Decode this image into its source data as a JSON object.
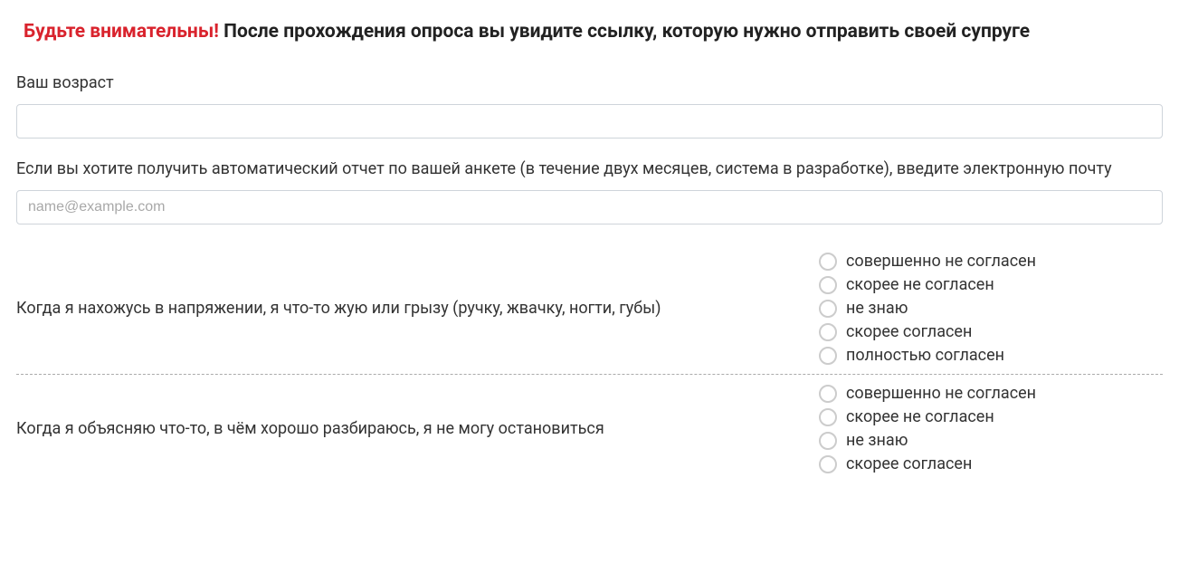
{
  "header": {
    "warning": "Будьте внимательны!",
    "text": "После прохождения опроса вы увидите ссылку, которую нужно отправить своей супруге"
  },
  "fields": {
    "age": {
      "label": "Ваш возраст",
      "value": ""
    },
    "email": {
      "label": "Если вы хотите получить автоматический отчет по вашей анкете (в течение двух месяцев, система в разработке), введите электронную почту",
      "placeholder": "name@example.com",
      "value": ""
    }
  },
  "radio_options": [
    "совершенно не согласен",
    "скорее не согласен",
    "не знаю",
    "скорее согласен",
    "полностью согласен"
  ],
  "questions": [
    {
      "text": "Когда я нахожусь в напряжении, я что-то жую или грызу (ручку, жвачку, ногти, губы)"
    },
    {
      "text": "Когда я объясняю что-то, в чём хорошо разбираюсь, я не могу остановиться"
    }
  ]
}
